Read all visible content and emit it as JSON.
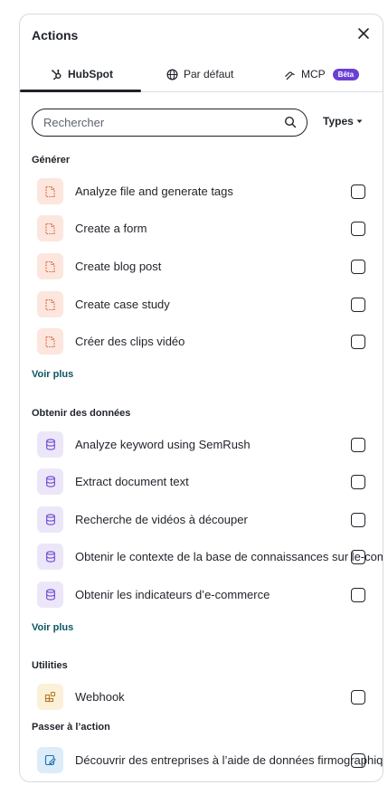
{
  "header": {
    "title": "Actions"
  },
  "tabs": [
    {
      "label": "HubSpot",
      "icon": "hubspot-sprocket-icon"
    },
    {
      "label": "Par défaut",
      "icon": "globe-icon"
    },
    {
      "label": "MCP",
      "icon": "mcp-icon",
      "badge": "Bêta"
    }
  ],
  "search": {
    "placeholder": "Rechercher",
    "value": ""
  },
  "filter": {
    "label": "Types"
  },
  "sections": {
    "generate": {
      "title": "Générer",
      "items": [
        {
          "label": "Analyze file and generate tags"
        },
        {
          "label": "Create a form"
        },
        {
          "label": "Create blog post"
        },
        {
          "label": "Create case study"
        },
        {
          "label": "Créer des clips vidéo"
        }
      ],
      "see_more": "Voir plus"
    },
    "data": {
      "title": "Obtenir des données",
      "items": [
        {
          "label": "Analyze keyword using SemRush"
        },
        {
          "label": "Extract document text"
        },
        {
          "label": "Recherche de vidéos à découper"
        },
        {
          "label": "Obtenir le contexte de la base de connaissances sur le-commerce"
        },
        {
          "label": "Obtenir les indicateurs d’e-commerce"
        }
      ],
      "see_more": "Voir plus"
    },
    "utilities": {
      "title": "Utilities",
      "items": [
        {
          "label": "Webhook"
        }
      ]
    },
    "action": {
      "title": "Passer à l’action",
      "items": [
        {
          "label": "Découvrir des entreprises à l’aide de données firmographiques"
        }
      ]
    }
  },
  "colors": {
    "accent": "#6a3fd4",
    "link": "#0e5660",
    "generate_icon_bg": "#fce6dd",
    "data_icon_bg": "#ece7f8"
  }
}
